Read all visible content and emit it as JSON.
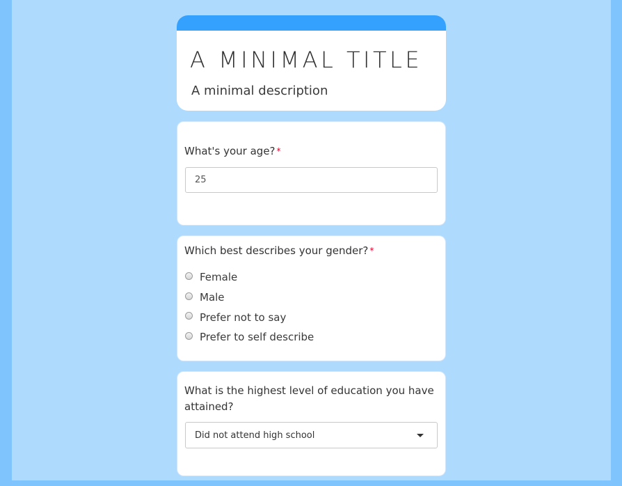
{
  "form": {
    "title": "A MINIMAL TITLE",
    "description": "A minimal description"
  },
  "questions": {
    "age": {
      "label": "What's your age?",
      "required_marker": "*",
      "value": "25"
    },
    "gender": {
      "label": "Which best describes your gender?",
      "required_marker": "*",
      "options": [
        "Female",
        "Male",
        "Prefer not to say",
        "Prefer to self describe"
      ]
    },
    "education": {
      "label": "What is the highest level of education you have attained?",
      "selected": "Did not attend high school"
    }
  },
  "colors": {
    "accent": "#34a1ff",
    "page_background": "#aedafe",
    "outer_background": "#7fc4fd",
    "required": "#e0002a"
  },
  "icons": {
    "select_caret": "caret-down-icon"
  }
}
